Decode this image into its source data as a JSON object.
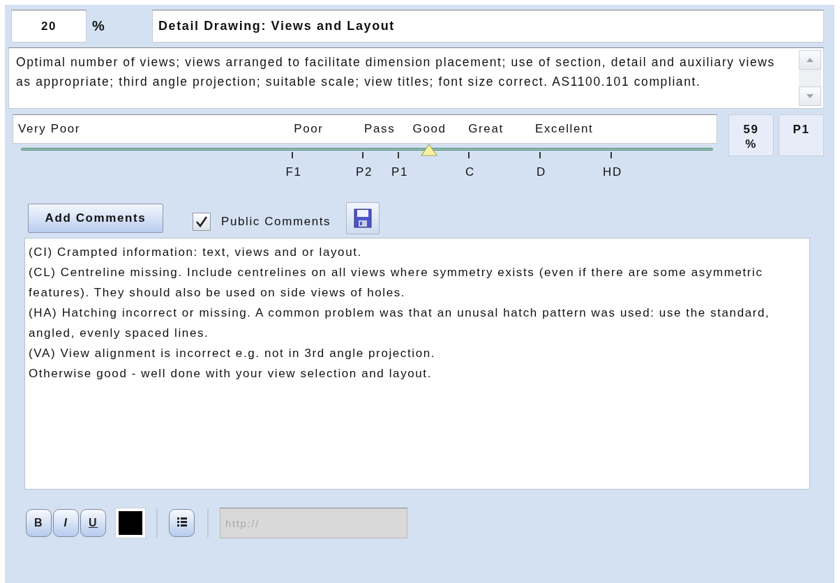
{
  "weight": {
    "value": "20",
    "unit": "%"
  },
  "title": "Detail Drawing: Views and Layout",
  "description": "Optimal number of views; views arranged to facilitate dimension placement; use of section, detail and auxiliary views as appropriate; third angle projection; suitable scale; view titles; font size correct. AS1100.101 compliant.",
  "rating": {
    "labels": [
      "Very Poor",
      "Poor",
      "Pass",
      "Good",
      "Great",
      "Excellent"
    ],
    "level": 0.59,
    "ticks": [
      "F1",
      "P2",
      "P1",
      "C",
      "D",
      "HD"
    ],
    "score": "59 %",
    "grade": "P1"
  },
  "comment_controls": {
    "add_button": "Add Comments",
    "public_comments": {
      "label": "Public Comments",
      "checked": true
    }
  },
  "comments": [
    "(CI) Crampted information: text, views and or layout.",
    "(CL) Centreline missing. Include centrelines on all views where symmetry exists (even if there are some asymmetric features). They should also be used on side views of holes.",
    "(HA) Hatching incorrect or missing. A common problem was that an unusal hatch pattern was used: use the standard, angled, evenly spaced lines.",
    "(VA) View alignment is incorrect e.g. not in 3rd angle projection.",
    "Otherwise good - well done with your view selection and layout."
  ],
  "format_toolbar": {
    "buttons": [
      {
        "kind": "bold",
        "label": "B"
      },
      {
        "kind": "italic",
        "label": "I"
      },
      {
        "kind": "underline",
        "label": "U"
      }
    ],
    "color_picker": {
      "color": "#000000"
    },
    "link_field": {
      "placeholder": "http://",
      "disabled": true
    }
  }
}
